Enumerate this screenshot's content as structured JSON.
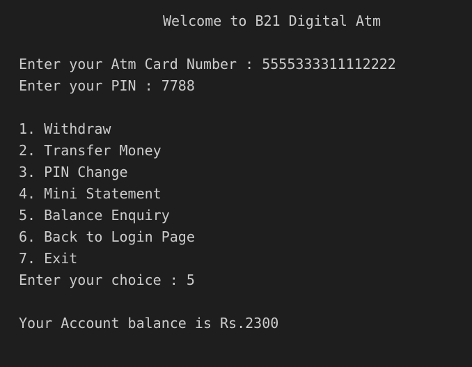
{
  "terminal": {
    "header": "Welcome to B21 Digital Atm",
    "card_prompt": "Enter your Atm Card Number : 5555333311112222",
    "pin_prompt": "Enter your PIN : 7788",
    "menu": [
      "1. Withdraw",
      "2. Transfer Money",
      "3. PIN Change",
      "4. Mini Statement",
      "5. Balance Enquiry",
      "6. Back to Login Page",
      "7. Exit"
    ],
    "choice_prompt": "Enter your choice : 5",
    "result": "Your Account balance is Rs.2300"
  },
  "colors": {
    "background": "#1e1e1e",
    "text": "#cccccc"
  }
}
